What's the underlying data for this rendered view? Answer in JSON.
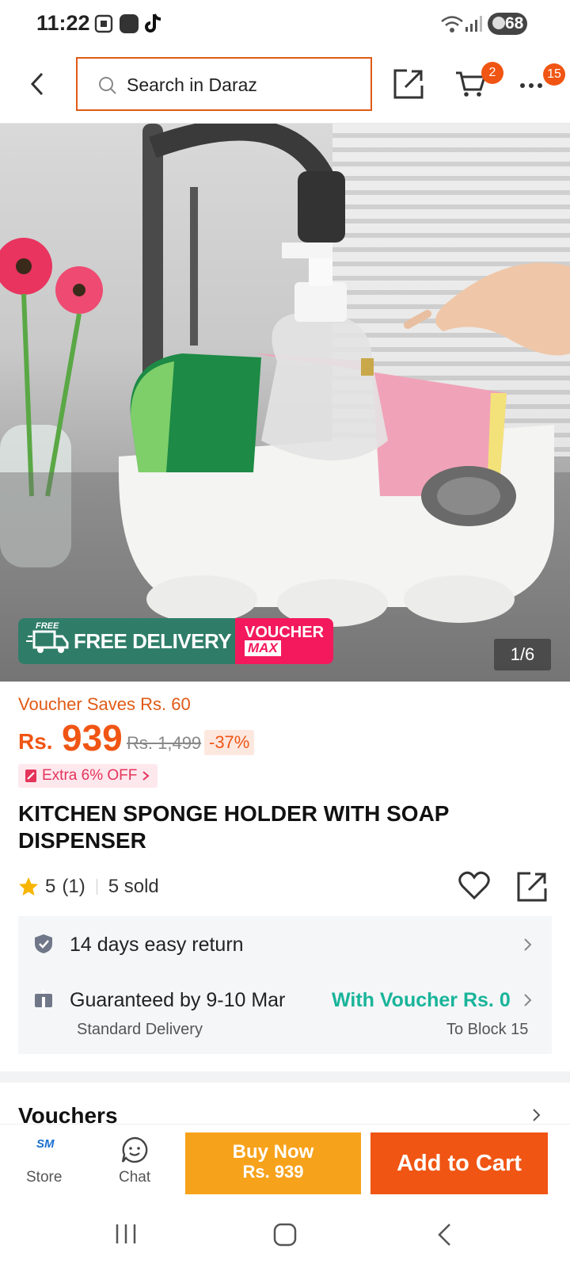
{
  "status_bar": {
    "time": "11:22",
    "battery": "68"
  },
  "header": {
    "search_placeholder": "Search in Daraz",
    "cart_count": "2",
    "more_count": "15"
  },
  "hero": {
    "image_counter": "1/6",
    "promo_free": "FREE",
    "promo_delivery": "FREE DELIVERY",
    "promo_voucher": "VOUCHER",
    "promo_max": "MAX"
  },
  "product": {
    "voucher_saves": "Voucher Saves Rs. 60",
    "currency": "Rs.",
    "price": "939",
    "original_price": "Rs. 1,499",
    "discount": "-37%",
    "extra_off": "Extra 6% OFF",
    "title": "KITCHEN SPONGE HOLDER WITH SOAP DISPENSER",
    "rating": "5",
    "rating_count": "(1)",
    "sold": "5 sold"
  },
  "service": {
    "return_text": "14 days easy return",
    "guarantee_text": "Guaranteed by 9-10 Mar",
    "delivery_type": "Standard Delivery",
    "voucher_text": "With Voucher Rs. 0",
    "destination": "To Block 15"
  },
  "sections": {
    "vouchers_title": "Vouchers"
  },
  "bottom_bar": {
    "store_label": "Store",
    "store_logo": "SM",
    "chat_label": "Chat",
    "buy_now_label": "Buy Now",
    "buy_now_price": "Rs. 939",
    "add_to_cart_label": "Add to Cart"
  },
  "colors": {
    "brand_orange": "#f05513",
    "buy_now_yellow": "#f7a21b",
    "teal": "#19b49a",
    "promo_green": "#2f7d68",
    "promo_pink": "#f3195c"
  },
  "icons": [
    "back-icon",
    "search-icon",
    "share-icon",
    "cart-icon",
    "more-icon",
    "star-icon",
    "heart-icon",
    "shield-icon",
    "delivery-icon",
    "chevron-right-icon",
    "chat-icon",
    "store-icon"
  ]
}
